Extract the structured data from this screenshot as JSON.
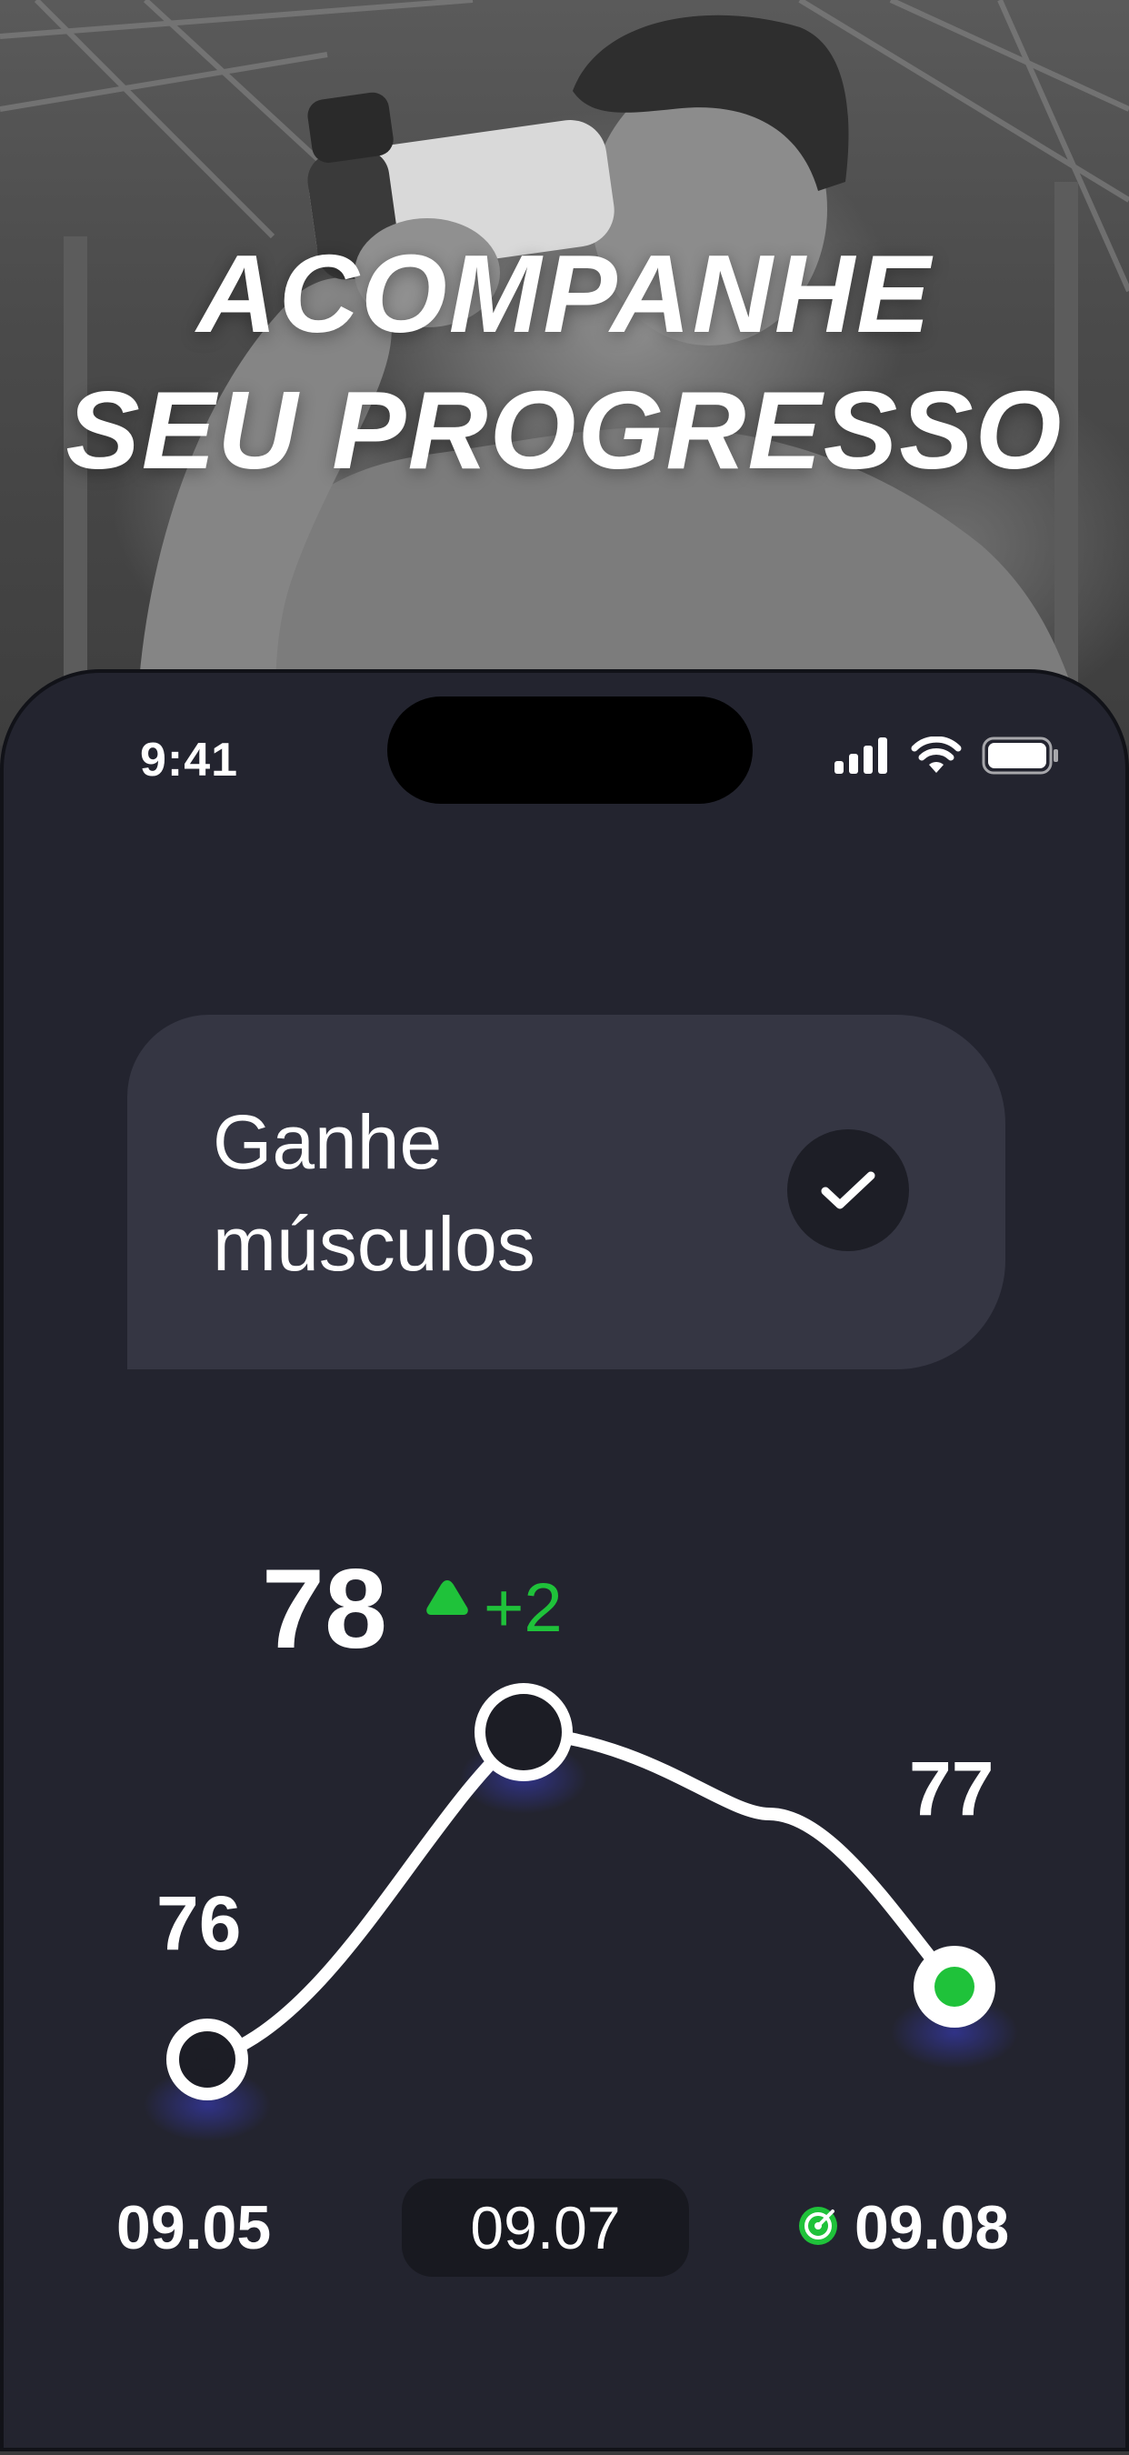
{
  "headline": {
    "line1": "ACOMPANHE",
    "line2": "SEU PROGRESSO"
  },
  "status_bar": {
    "time": "9:41",
    "icons": [
      "cellular-signal-icon",
      "wifi-icon",
      "battery-icon"
    ]
  },
  "goal_card": {
    "line1": "Ganhe",
    "line2": "músculos",
    "icon": "checkmark-icon"
  },
  "progress": {
    "current_value": "78",
    "delta_icon": "triangle-up-icon",
    "delta": "+2"
  },
  "colors": {
    "background": "#23242f",
    "card": "#353643",
    "accent_green": "#1fc23a",
    "text": "#ffffff"
  },
  "chart_data": {
    "type": "line",
    "x": [
      "09.05",
      "09.07",
      "09.08"
    ],
    "point_labels": [
      "76",
      "",
      "77"
    ],
    "series": [
      {
        "values": [
          76,
          78,
          77
        ]
      }
    ],
    "selected_x": "09.07",
    "target_marker_x": "09.08"
  }
}
